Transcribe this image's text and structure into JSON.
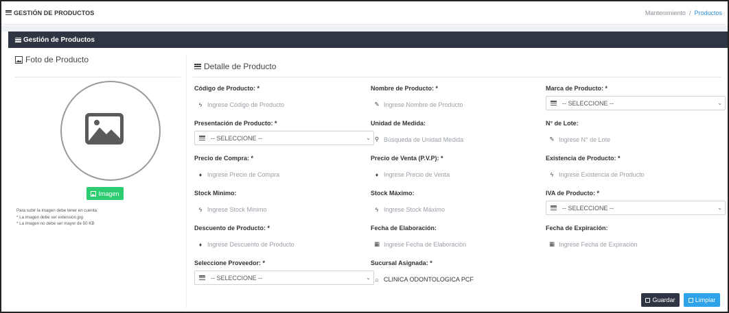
{
  "header": {
    "title": "GESTIÓN DE PRODUCTOS",
    "breadcrumb": [
      "Mantenimiento",
      "/",
      "Productos"
    ]
  },
  "panel": {
    "title": "Gestión de Productos"
  },
  "photo": {
    "title": "Foto de Producto",
    "button_label": "Imagen",
    "notes": [
      "Para subir la imagen debe tener en cuenta:",
      "* La imagen debe ser extension.jpg",
      "* La imagen no debe ser mayor de 50 KB"
    ]
  },
  "detail": {
    "title": "Detalle de Producto",
    "fields": {
      "codigo": {
        "label": "Código de Producto: *",
        "placeholder": "Ingrese Código de Producto",
        "icon": "bolt-icon"
      },
      "nombre": {
        "label": "Nombre de Producto: *",
        "placeholder": "Ingrese Nombre de Producto",
        "icon": "pencil-icon"
      },
      "marca": {
        "label": "Marca de Producto: *",
        "value": "-- SELECCIONE --"
      },
      "presentacion": {
        "label": "Presentación de Producto: *",
        "value": "-- SELECCIONE --"
      },
      "unidad": {
        "label": "Unidad de Medida:",
        "placeholder": "Búsqueda de Unidad Medida",
        "icon": "search-icon"
      },
      "lote": {
        "label": "N° de Lote:",
        "placeholder": "Ingrese N° de Lote",
        "icon": "pencil-icon"
      },
      "compra": {
        "label": "Precio de Compra: *",
        "placeholder": "Ingrese Precio de Compra",
        "icon": "drop-icon"
      },
      "venta": {
        "label": "Precio de Venta (P.V.P): *",
        "placeholder": "Ingrese Precio de Venta",
        "icon": "drop-icon"
      },
      "existencia": {
        "label": "Existencia de Producto: *",
        "placeholder": "Ingrese Existencia de Producto",
        "icon": "bolt-icon"
      },
      "stockmin": {
        "label": "Stock Minimo:",
        "placeholder": "Ingrese Stock Minimo",
        "icon": "bolt-icon"
      },
      "stockmax": {
        "label": "Stock Máximo:",
        "placeholder": "Ingrese Stock Máximo",
        "icon": "bolt-icon"
      },
      "iva": {
        "label": "IVA de Producto: *",
        "value": "-- SELECCIONE --"
      },
      "descuento": {
        "label": "Descuento de Producto: *",
        "placeholder": "Ingrese Descuento de Producto",
        "icon": "drop-icon"
      },
      "elaboracion": {
        "label": "Fecha de Elaboración:",
        "placeholder": "Ingrese Fecha de Elaboración",
        "icon": "calendar-icon"
      },
      "expiracion": {
        "label": "Fecha de Expiración:",
        "placeholder": "Ingrese Fecha de Expiración",
        "icon": "calendar-icon"
      },
      "proveedor": {
        "label": "Seleccione Proveedor: *",
        "value": "-- SELECCIONE --"
      },
      "sucursal": {
        "label": "Sucursal Asignada: *",
        "value": "CLINICA ODONTOLOGICA PCF",
        "icon": "bank-icon"
      }
    }
  },
  "actions": {
    "save": "Guardar",
    "clear": "Limpiar"
  },
  "colors": {
    "header_dark": "#2f3542",
    "save": "#2f3542",
    "clear": "#2fa3ea",
    "image_button": "#2ecc71",
    "breadcrumb_active": "#2a8fd8"
  }
}
